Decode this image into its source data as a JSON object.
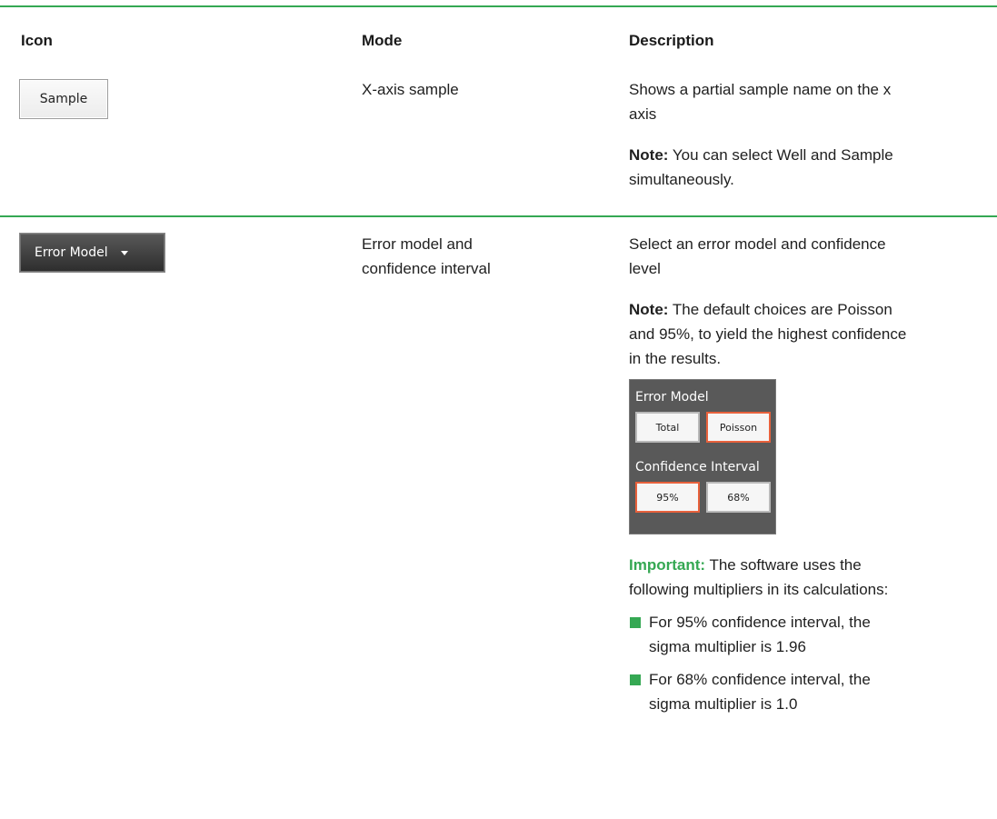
{
  "headers": {
    "icon": "Icon",
    "mode": "Mode",
    "description": "Description"
  },
  "rows": [
    {
      "icon_label": "Sample",
      "mode": "X-axis sample",
      "description": "Shows a partial sample name on the x axis",
      "note_label": "Note:",
      "note_text": " You can select Well and Sample simultaneously."
    },
    {
      "icon_label": "Error Model",
      "mode": "Error model and confidence interval",
      "description": "Select an error model and confidence level",
      "note_label": "Note:",
      "note_text": " The default choices are Poisson and 95%, to yield the highest confidence in the results.",
      "panel": {
        "title1": "Error Model",
        "btn_total": "Total",
        "btn_poisson": "Poisson",
        "title2": "Confidence Interval",
        "btn_95": "95%",
        "btn_68": "68%"
      },
      "important_label": "Important:",
      "important_text": " The software uses the following multipliers in its calculations:",
      "bullets": [
        "For 95% confidence interval, the sigma multiplier is 1.96",
        "For 68% confidence interval, the sigma multiplier is 1.0"
      ]
    }
  ],
  "colors": {
    "accent_green": "#35a853",
    "selected_orange": "#e8613c",
    "panel_gray": "#595959"
  }
}
